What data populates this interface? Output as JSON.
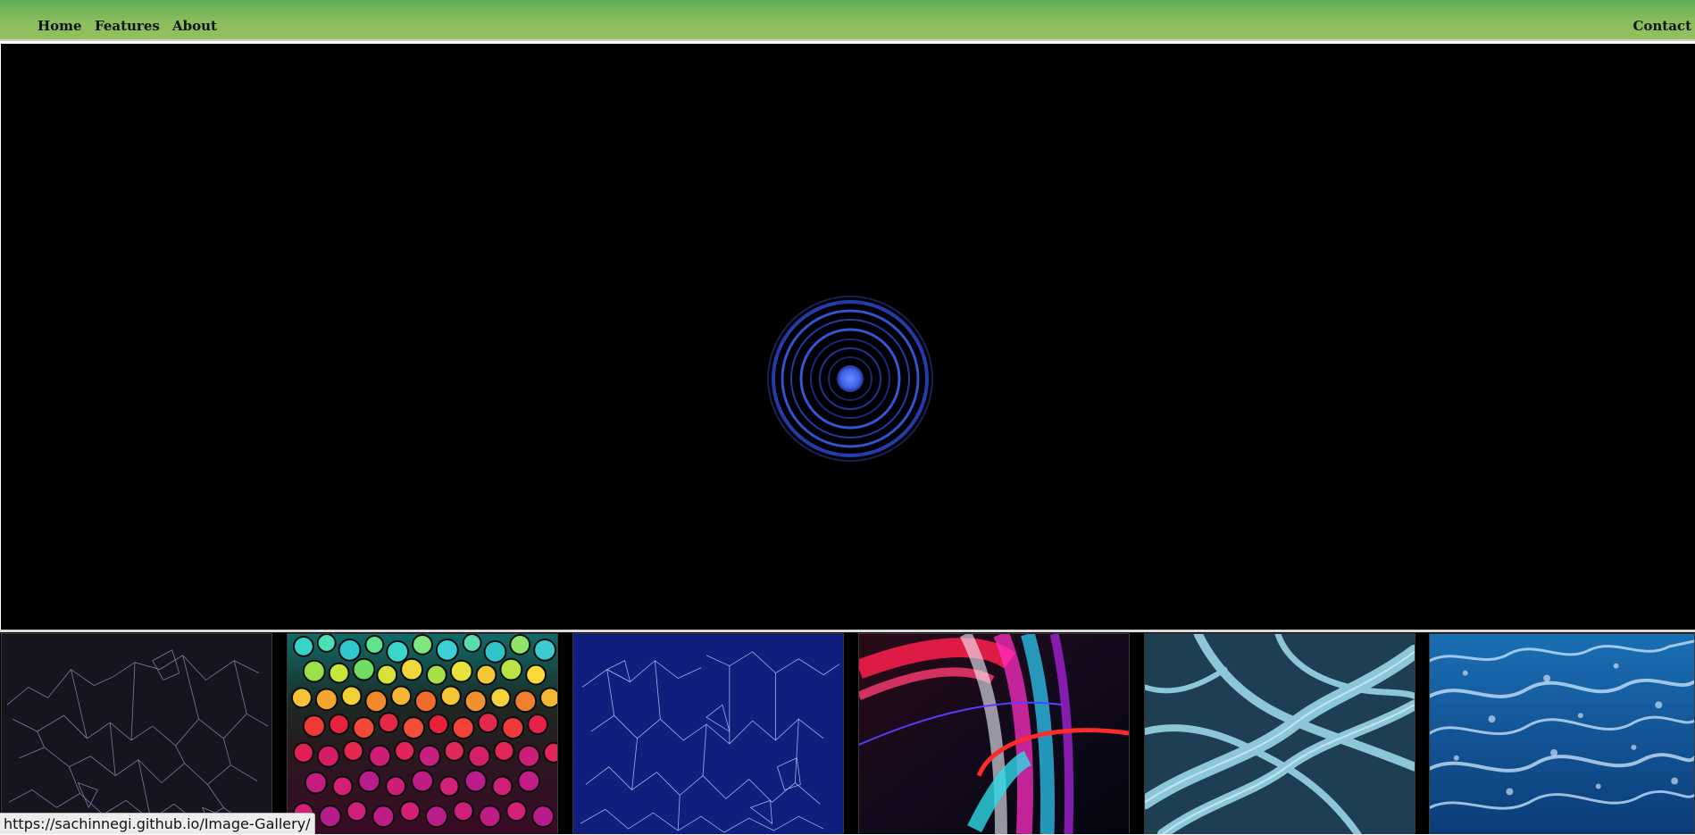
{
  "nav": {
    "items": [
      {
        "label": "Home"
      },
      {
        "label": "Features"
      },
      {
        "label": "About"
      }
    ],
    "right_item": {
      "label": "Contact"
    }
  },
  "hero": {
    "background": "#000000",
    "loader_icon": "concentric-rings-loader",
    "loader_color": "#3f63ff"
  },
  "gallery": {
    "items": [
      {
        "name": "network-lines-dark"
      },
      {
        "name": "colorful-cells"
      },
      {
        "name": "network-lines-blue"
      },
      {
        "name": "neon-light-streaks"
      },
      {
        "name": "aerial-river-braids"
      },
      {
        "name": "ocean-waves"
      }
    ]
  },
  "status": {
    "url": "https://sachinnegi.github.io/Image-Gallery/"
  },
  "colors": {
    "nav_gradient_top": "#5fae57",
    "nav_gradient_bottom": "#94c05f",
    "page_background": "#000000"
  }
}
